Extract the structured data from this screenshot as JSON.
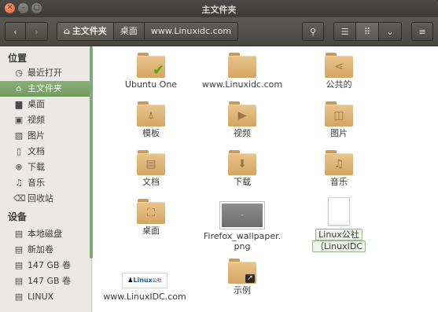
{
  "window": {
    "title": "主文件夹"
  },
  "titlebar": {
    "close_glyph": "✕",
    "min_glyph": "–",
    "max_glyph": "▢"
  },
  "toolbar": {
    "back_glyph": "‹",
    "forward_glyph": "›",
    "breadcrumbs": [
      "主文件夹",
      "桌面",
      "www.Linuxidc.com"
    ],
    "search_glyph": "⚲",
    "list_glyph": "☰",
    "grid_glyph": "⠿",
    "more_glyph": "⌄",
    "menu_glyph": "≡"
  },
  "sidebar": {
    "section_places": "位置",
    "section_devices": "设备",
    "places": [
      {
        "label": "最近打开",
        "icon": "clock-icon",
        "glyph": "◷"
      },
      {
        "label": "主文件夹",
        "icon": "home-icon",
        "glyph": "⌂",
        "active": true
      },
      {
        "label": "桌面",
        "icon": "desktop-icon",
        "glyph": "▆"
      },
      {
        "label": "视频",
        "icon": "video-icon",
        "glyph": "▣"
      },
      {
        "label": "图片",
        "icon": "picture-icon",
        "glyph": "▨"
      },
      {
        "label": "文档",
        "icon": "document-icon",
        "glyph": "▯"
      },
      {
        "label": "下载",
        "icon": "download-icon",
        "glyph": "⊕"
      },
      {
        "label": "音乐",
        "icon": "music-icon",
        "glyph": "♫"
      },
      {
        "label": "回收站",
        "icon": "trash-icon",
        "glyph": "⌫"
      }
    ],
    "devices": [
      {
        "label": "本地磁盘",
        "icon": "drive-icon",
        "glyph": "▤"
      },
      {
        "label": "新加卷",
        "icon": "drive-icon",
        "glyph": "▤"
      },
      {
        "label": "147 GB 卷",
        "icon": "drive-icon",
        "glyph": "▤"
      },
      {
        "label": "147 GB 卷",
        "icon": "drive-icon",
        "glyph": "▤"
      },
      {
        "label": "LINUX",
        "icon": "drive-icon",
        "glyph": "▤"
      }
    ]
  },
  "files": [
    {
      "label": "Ubuntu One",
      "kind": "folder",
      "icon": "ubuntu-one-folder-icon"
    },
    {
      "label": "www.Linuxidc.com",
      "kind": "folder",
      "icon": "folder-icon"
    },
    {
      "label": "公共的",
      "kind": "folder",
      "icon": "share-folder-icon",
      "emblem": "⋖"
    },
    {
      "label": "模板",
      "kind": "folder",
      "icon": "templates-folder-icon",
      "emblem": "⍋"
    },
    {
      "label": "视频",
      "kind": "folder",
      "icon": "videos-folder-icon",
      "emblem": "▶"
    },
    {
      "label": "图片",
      "kind": "folder",
      "icon": "pictures-folder-icon",
      "emblem": "◫"
    },
    {
      "label": "文档",
      "kind": "folder",
      "icon": "documents-folder-icon",
      "emblem": "▤"
    },
    {
      "label": "下载",
      "kind": "folder",
      "icon": "downloads-folder-icon",
      "emblem": "⬇"
    },
    {
      "label": "音乐",
      "kind": "folder",
      "icon": "music-folder-icon",
      "emblem": "♫"
    },
    {
      "label": "桌面",
      "kind": "folder",
      "icon": "desktop-folder-icon",
      "emblem": "⛶"
    },
    {
      "label": "Firefox_wallpaper.",
      "label2": "png",
      "kind": "image",
      "icon": "image-thumbnail"
    },
    {
      "label": "Linux公社",
      "label2": "（LinuxIDC",
      "kind": "document",
      "icon": "document-icon",
      "selected": true
    },
    {
      "label": "www.LinuxIDC.com",
      "kind": "weblink",
      "icon": "linux-logo-icon",
      "logo_text": "Linux",
      "logo_sub": "公社"
    },
    {
      "label": "示例",
      "kind": "folder",
      "icon": "examples-folder-icon",
      "link_glyph": "↗"
    }
  ],
  "colors": {
    "accent": "#7fa87a",
    "folder": "#dcb072",
    "titlebar": "#3c3b37"
  }
}
